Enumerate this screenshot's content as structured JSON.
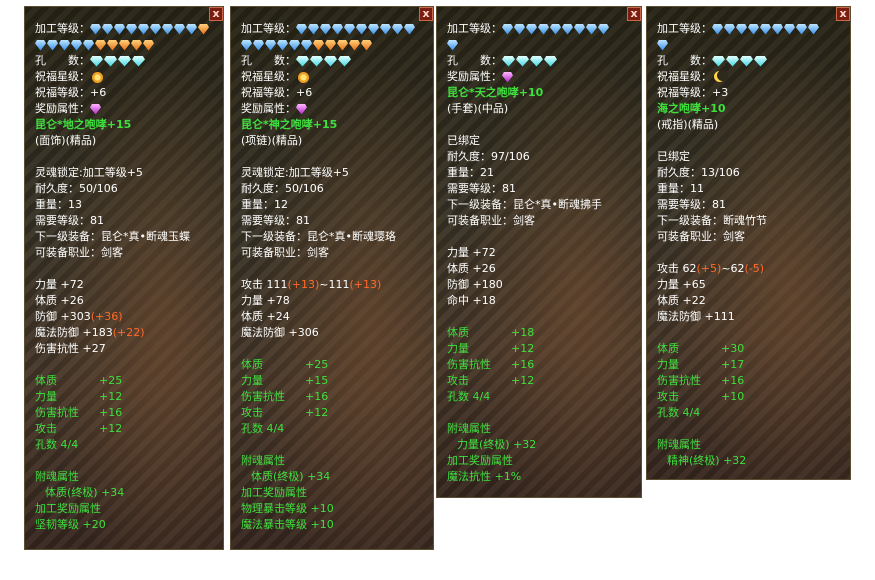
{
  "common": {
    "label_process_level": "加工等级：",
    "label_holes": "孔　　数：",
    "label_bless_star": "祝福星级：",
    "label_bless_level": "祝福等级：",
    "label_reward_attr": "奖励属性：",
    "close": "x"
  },
  "panels": [
    {
      "bless_level": "+6",
      "name": "昆仑*地之咆哮+15",
      "type": "(面饰)(精品)",
      "soul_lock": "灵魂锁定:加工等级+5",
      "durability": "耐久度：50/106",
      "weight": "重量：13",
      "req_level": "需要等级：81",
      "next_equip": "下一级装备：昆仑*真•断魂玉蝶",
      "job": "可装备职业：剑客",
      "stats": [
        {
          "label": "力量 +72",
          "bonus": ""
        },
        {
          "label": "体质 +26",
          "bonus": ""
        },
        {
          "label": "防御 +303",
          "bonus": "(+36)"
        },
        {
          "label": "魔法防御 +183",
          "bonus": "(+22)"
        },
        {
          "label": "伤害抗性 +27",
          "bonus": ""
        }
      ],
      "green_stats": [
        {
          "name": "体质",
          "value": "+25"
        },
        {
          "name": "力量",
          "value": "+12"
        },
        {
          "name": "伤害抗性",
          "value": "+16"
        },
        {
          "name": "攻击",
          "value": "+12"
        },
        {
          "name": "孔数",
          "value": "4/4"
        }
      ],
      "soul_attr_title": "附魂属性",
      "soul_attr": "体质(终极) +34",
      "process_reward_title": "加工奖励属性",
      "process_reward": "坚韧等级 +20"
    },
    {
      "bless_level": "+6",
      "name": "昆仑*神之咆哮+15",
      "type": "(项链)(精品)",
      "soul_lock": "灵魂锁定:加工等级+5",
      "durability": "耐久度：50/106",
      "weight": "重量：12",
      "req_level": "需要等级：81",
      "next_equip": "下一级装备：昆仑*真•断魂璎珞",
      "job": "可装备职业：剑客",
      "attack": "攻击 111",
      "attack_b1": "(+13)",
      "attack_mid": "~111",
      "attack_b2": "(+13)",
      "stats": [
        {
          "label": "力量 +78",
          "bonus": ""
        },
        {
          "label": "体质 +24",
          "bonus": ""
        },
        {
          "label": "魔法防御 +306",
          "bonus": ""
        }
      ],
      "green_stats": [
        {
          "name": "体质",
          "value": "+25"
        },
        {
          "name": "力量",
          "value": "+15"
        },
        {
          "name": "伤害抗性",
          "value": "+16"
        },
        {
          "name": "攻击",
          "value": "+12"
        },
        {
          "name": "孔数",
          "value": "4/4"
        }
      ],
      "soul_attr_title": "附魂属性",
      "soul_attr": "体质(终极) +34",
      "process_reward_title": "加工奖励属性",
      "process_reward_1": "物理暴击等级 +10",
      "process_reward_2": "魔法暴击等级 +10"
    },
    {
      "name": "昆仑*天之咆哮+10",
      "type": "(手套)(中品)",
      "bound": "已绑定",
      "durability": "耐久度：97/106",
      "weight": "重量：21",
      "req_level": "需要等级：81",
      "next_equip": "下一级装备：昆仑*真•断魂拂手",
      "job": "可装备职业：剑客",
      "stats": [
        {
          "label": "力量 +72",
          "bonus": ""
        },
        {
          "label": "体质 +26",
          "bonus": ""
        },
        {
          "label": "防御 +180",
          "bonus": ""
        },
        {
          "label": "命中 +18",
          "bonus": ""
        }
      ],
      "green_stats": [
        {
          "name": "体质",
          "value": "+18"
        },
        {
          "name": "力量",
          "value": "+12"
        },
        {
          "name": "伤害抗性",
          "value": "+16"
        },
        {
          "name": "攻击",
          "value": "+12"
        },
        {
          "name": "孔数",
          "value": "4/4"
        }
      ],
      "soul_attr_title": "附魂属性",
      "soul_attr": "力量(终极) +32",
      "process_reward_title": "加工奖励属性",
      "process_reward": "魔法抗性 +1%"
    },
    {
      "bless_level": "+3",
      "name": "海之咆哮+10",
      "type": "(戒指)(精品)",
      "bound": "已绑定",
      "durability": "耐久度：13/106",
      "weight": "重量：11",
      "req_level": "需要等级：81",
      "next_equip": "下一级装备：断魂竹节",
      "job": "可装备职业：剑客",
      "attack": "攻击 62",
      "attack_b1": "(+5)",
      "attack_mid": "~62",
      "attack_b2": "(-5)",
      "stats": [
        {
          "label": "力量 +65",
          "bonus": ""
        },
        {
          "label": "体质 +22",
          "bonus": ""
        },
        {
          "label": "魔法防御 +111",
          "bonus": ""
        }
      ],
      "green_stats": [
        {
          "name": "体质",
          "value": "+30"
        },
        {
          "name": "力量",
          "value": "+17"
        },
        {
          "name": "伤害抗性",
          "value": "+16"
        },
        {
          "name": "攻击",
          "value": "+10"
        },
        {
          "name": "孔数",
          "value": "4/4"
        }
      ],
      "soul_attr_title": "附魂属性",
      "soul_attr": "精神(终极) +32"
    }
  ]
}
